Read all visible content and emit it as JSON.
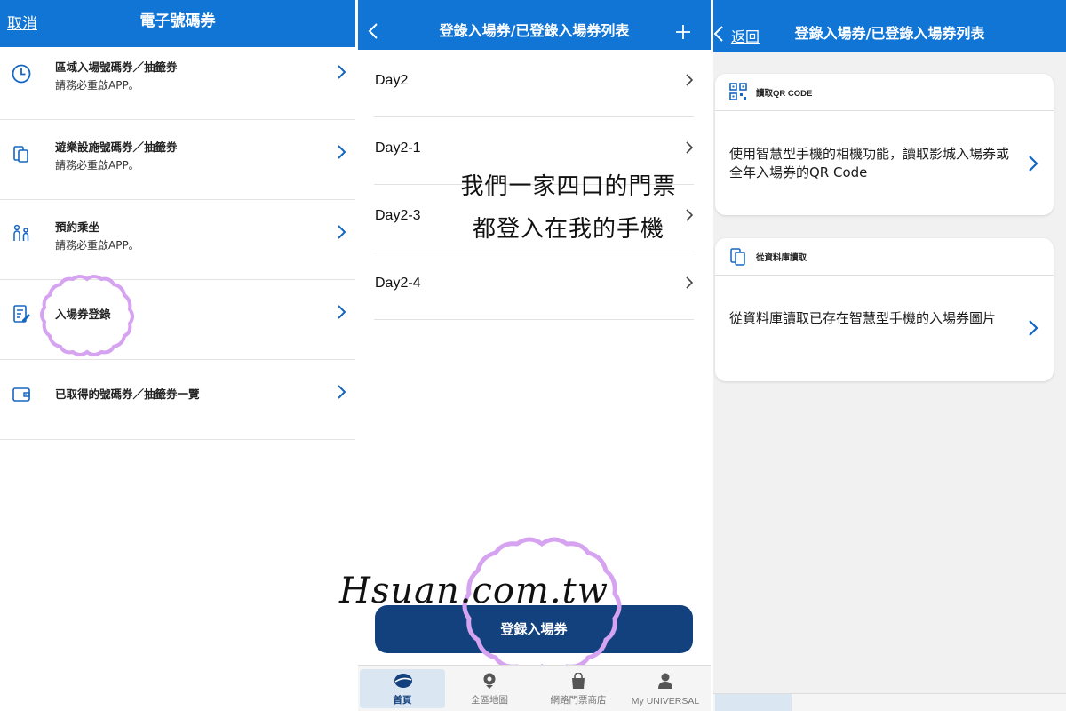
{
  "panel1": {
    "cancel": "取消",
    "title": "電子號碼券",
    "items": [
      {
        "icon": "clock-icon",
        "title": "區域入場號碼券／抽籤券",
        "subtitle": "請務必重啟APP。"
      },
      {
        "icon": "phone-tickets-icon",
        "title": "遊樂設施號碼券／抽籤券",
        "subtitle": "請務必重啟APP。"
      },
      {
        "icon": "people-icon",
        "title": "預約乘坐",
        "subtitle": "請務必重啟APP。"
      },
      {
        "icon": "edit-document-icon",
        "title": "入場券登錄",
        "subtitle": ""
      },
      {
        "icon": "wallet-icon",
        "title": "已取得的號碼券／抽籤券一覽",
        "subtitle": ""
      }
    ]
  },
  "panel2": {
    "title": "登錄入場券/已登錄入場券列表",
    "days": [
      "Day2",
      "Day2-1",
      "Day2-3",
      "Day2-4"
    ],
    "overlay_line1": "我們一家四口的門票",
    "overlay_line2": "都登入在我的手機",
    "register_button": "登録入場券",
    "watermark": "Hsuan.com.tw",
    "tabs": [
      {
        "label": "首頁",
        "icon": "globe-icon",
        "active": true
      },
      {
        "label": "全區地圖",
        "icon": "map-pin-icon",
        "active": false
      },
      {
        "label": "網路門票商店",
        "icon": "shopping-bag-icon",
        "active": false
      },
      {
        "label": "My UNIVERSAL",
        "icon": "user-icon",
        "active": false
      }
    ]
  },
  "panel3": {
    "back": "返回",
    "title": "登錄入場券/已登錄入場券列表",
    "cards": [
      {
        "icon": "qr-code-icon",
        "header": "讀取QR CODE",
        "body": "使用智慧型手機的相機功能，讀取影城入場券或全年入場券的QR Code"
      },
      {
        "icon": "phone-tickets-icon",
        "header": "從資料庫讀取",
        "body": "從資料庫讀取已存在智慧型手機的入場券圖片"
      }
    ]
  },
  "colors": {
    "header_blue": "#1175d6",
    "button_navy": "#13417e",
    "accent_chevron": "#1166c4",
    "highlight_purple": "#d6a3f0"
  }
}
